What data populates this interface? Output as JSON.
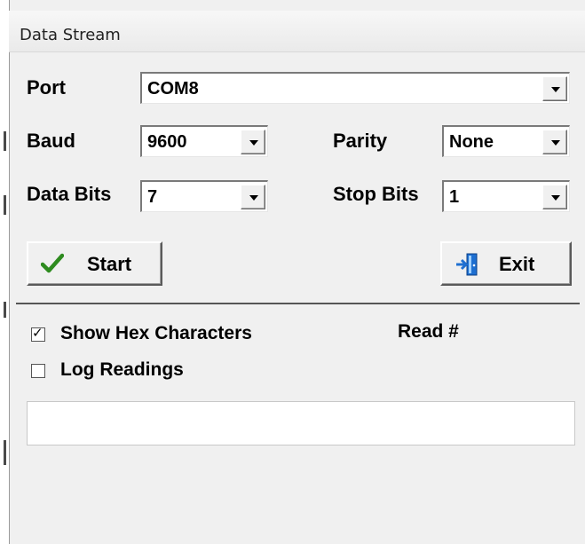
{
  "window": {
    "title": "Data Stream"
  },
  "port": {
    "label": "Port",
    "value": "COM8"
  },
  "baud": {
    "label": "Baud",
    "value": "9600"
  },
  "parity": {
    "label": "Parity",
    "value": "None"
  },
  "data_bits": {
    "label": "Data Bits",
    "value": "7"
  },
  "stop_bits": {
    "label": "Stop Bits",
    "value": "1"
  },
  "buttons": {
    "start": "Start",
    "exit": "Exit"
  },
  "options": {
    "show_hex": {
      "label": "Show Hex Characters",
      "checked": true
    },
    "log_readings": {
      "label": "Log Readings",
      "checked": false
    }
  },
  "read_label": "Read #",
  "readout_value": "",
  "icons": {
    "start": "checkmark-icon",
    "exit": "exit-door-icon",
    "dropdown": "chevron-down-icon"
  },
  "colors": {
    "background": "#f0f0f0",
    "checkmark": "#2e8b1f",
    "exit_icon": "#1e6fd1"
  }
}
